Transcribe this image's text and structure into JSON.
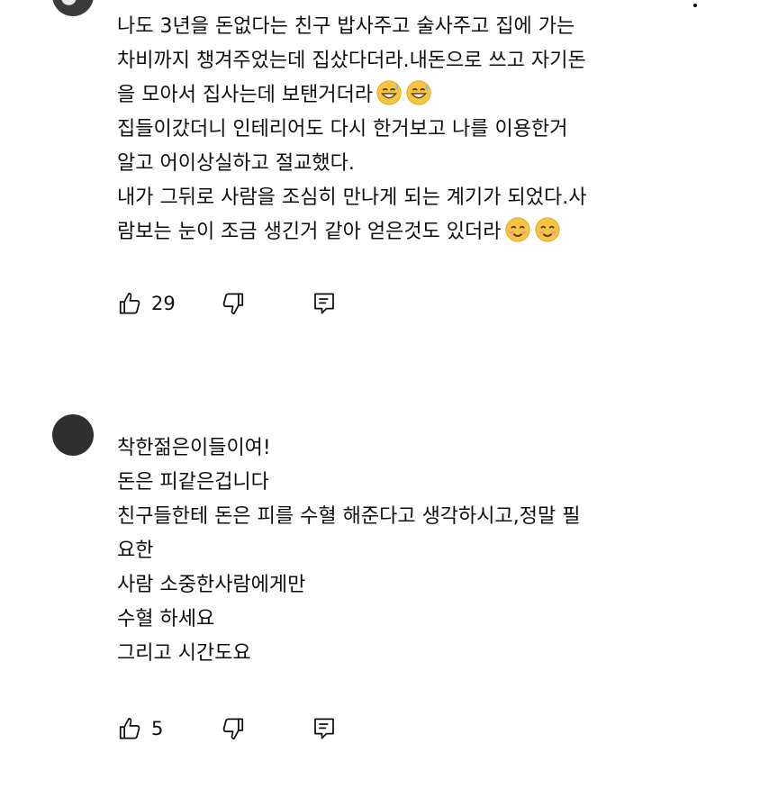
{
  "comments": [
    {
      "text_lines": [
        "나도 3년을 돈없다는 친구 밥사주고 술사주고 집에 가는",
        "차비까지 챙겨주었는데 집샀다더라.내돈으로 쓰고 자기돈",
        "을 모아서 집사는데 보탠거더라",
        "집들이갔더니 인테리어도 다시 한거보고  나를 이용한거",
        "알고 어이상실하고 절교했다.",
        "내가 그뒤로 사람을 조심히 만나게 되는 계기가 되었다.사",
        "람보는 눈이 조금 생긴거 같아 얻은것도 있더라"
      ],
      "emojis_line3": [
        "grinning-sweat-emoji",
        "grinning-sweat-emoji"
      ],
      "emojis_line7": [
        "smiling-blush-emoji",
        "smiling-blush-emoji"
      ],
      "likes": "29"
    },
    {
      "text_lines": [
        "착한젊은이들이여!",
        "돈은 피같은겁니다",
        "친구들한테 돈은 피를 수혈 해준다고 생각하시고,정말 필",
        "요한",
        "사람 소중한사람에게만",
        "수혈 하세요",
        "그리고 시간도요"
      ],
      "likes": "5"
    }
  ],
  "icons": {
    "like": "thumbs-up-icon",
    "dislike": "thumbs-down-icon",
    "reply": "reply-comment-icon",
    "more": "more-options-icon"
  },
  "colors": {
    "text": "#0f0f0f",
    "background": "#ffffff",
    "emoji_face": "#f7c441"
  }
}
